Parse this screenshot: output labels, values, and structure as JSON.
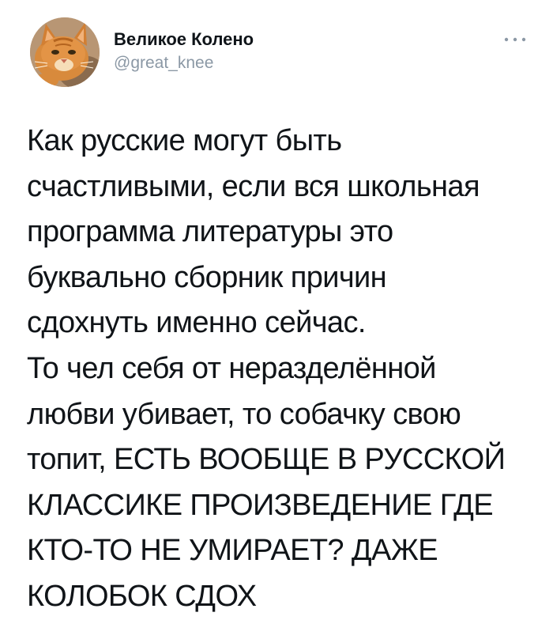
{
  "tweet": {
    "author": {
      "display_name": "Великое Колено",
      "handle": "@great_knee",
      "avatar_icon": "cat-avatar-icon"
    },
    "more_icon": "more-horizontal-icon",
    "text_lines": [
      "Как русские могут быть",
      "счастливыми, если вся школьная",
      "программа литературы это",
      "буквально сборник причин",
      "сдохнуть именно сейчас.",
      "То чел себя от неразделённой",
      "любви убивает, то собачку свою",
      "топит, ЕСТЬ ВООБЩЕ В РУССКОЙ",
      "КЛАССИКЕ ПРОИЗВЕДЕНИЕ ГДЕ",
      "КТО-ТО НЕ УМИРАЕТ? ДАЖЕ",
      "КОЛОБОК СДОХ"
    ],
    "colors": {
      "text": "#101418",
      "handle": "#8b98a5",
      "background": "#ffffff"
    }
  }
}
